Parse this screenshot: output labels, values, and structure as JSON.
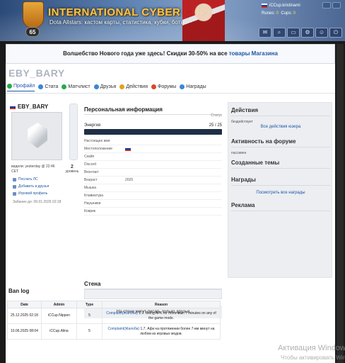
{
  "header": {
    "title": "INTERNATIONAL CYBER CUP",
    "subtitle": "Dota Allstars: кастом карты, статистика, кубки, боты",
    "logo_level": "65",
    "user": {
      "name": "iCCup.kristinami",
      "runes_label": "Runes:",
      "runes_value": "0",
      "cups_label": "Cups:",
      "cups_value": "0"
    },
    "icons": [
      "mail-icon",
      "search-icon",
      "cart-icon",
      "settings-icon",
      "user-icon",
      "exit-icon"
    ]
  },
  "promo": {
    "text": "Волшебство Нового года уже здесь! Скидки 30-50% на все ",
    "link": "товары Магазина"
  },
  "profile": {
    "username": "EBY_BARY",
    "tabs": [
      {
        "label": "Профайл",
        "color": "#2aa84a"
      },
      {
        "label": "Стата",
        "color": "#3a86d6"
      },
      {
        "label": "Матчлист",
        "color": "#2aa84a"
      },
      {
        "label": "Друзья",
        "color": "#3a86d6"
      },
      {
        "label": "Действия",
        "color": "#e0a020"
      },
      {
        "label": "Форумы",
        "color": "#d84a2a"
      },
      {
        "label": "Награды",
        "color": "#3a86d6"
      }
    ],
    "card": {
      "name": "EBY_BARY",
      "seen": "видели: yesterday @ 22:46 CET",
      "level_value": "2",
      "level_label": "уровень",
      "links": [
        "Послать ЛС",
        "Добавить в друзья",
        "Игровой профиль"
      ],
      "banned": "Забанен до: 09.01.2026 02:18"
    },
    "personal": {
      "title": "Персональная информация",
      "status_label": "Статус",
      "energy_label": "Энергия",
      "energy_value": "25 / 25",
      "energy_fraction": 1.0,
      "rows": [
        {
          "label": "Настоящее имя",
          "value": ""
        },
        {
          "label": "Местоположение",
          "value": ""
        },
        {
          "label": "Скайп",
          "value": ""
        },
        {
          "label": "Discord",
          "value": ""
        },
        {
          "label": "Вконтакт",
          "value": ""
        },
        {
          "label": "Возраст",
          "value": "2025"
        },
        {
          "label": "Мышка",
          "value": ""
        },
        {
          "label": "Клавиатура",
          "value": ""
        },
        {
          "label": "Наушники",
          "value": ""
        },
        {
          "label": "Коврик",
          "value": ""
        }
      ]
    },
    "wall": {
      "title": "Стена",
      "note": "На стене могут писать только друзья"
    },
    "right": {
      "actions_title": "Действия",
      "actions_small": "бездействует",
      "actions_link": "Все действия юзера",
      "forum_title": "Активность на форуме",
      "forum_small": "пассивен",
      "topics_title": "Созданные темы",
      "awards_title": "Награды",
      "awards_link": "Посмотреть все награды",
      "ads_title": "Реклама"
    },
    "banlog": {
      "title": "Ban log",
      "columns": [
        "Date",
        "Admin",
        "Type",
        "Reason"
      ],
      "rows": [
        {
          "date": "25.12.2025 02:18",
          "admin": "iCCup.Nippon",
          "type": "5",
          "tag": "Complaint(Жалоба)",
          "reason": " 1.7. Being AFK for more than 7 minutes on any of the game mods."
        },
        {
          "date": "10.06.2025 08:04",
          "admin": "iCCup.Alina",
          "type": "5",
          "tag": "Complaint(Жалоба)",
          "reason": " 1.7. Афк на протяжении более 7-ми минут на любом из игровых модов."
        }
      ]
    }
  },
  "watermark": {
    "line1": "Активация Windows",
    "line2": "Чтобы активировать Windows"
  }
}
